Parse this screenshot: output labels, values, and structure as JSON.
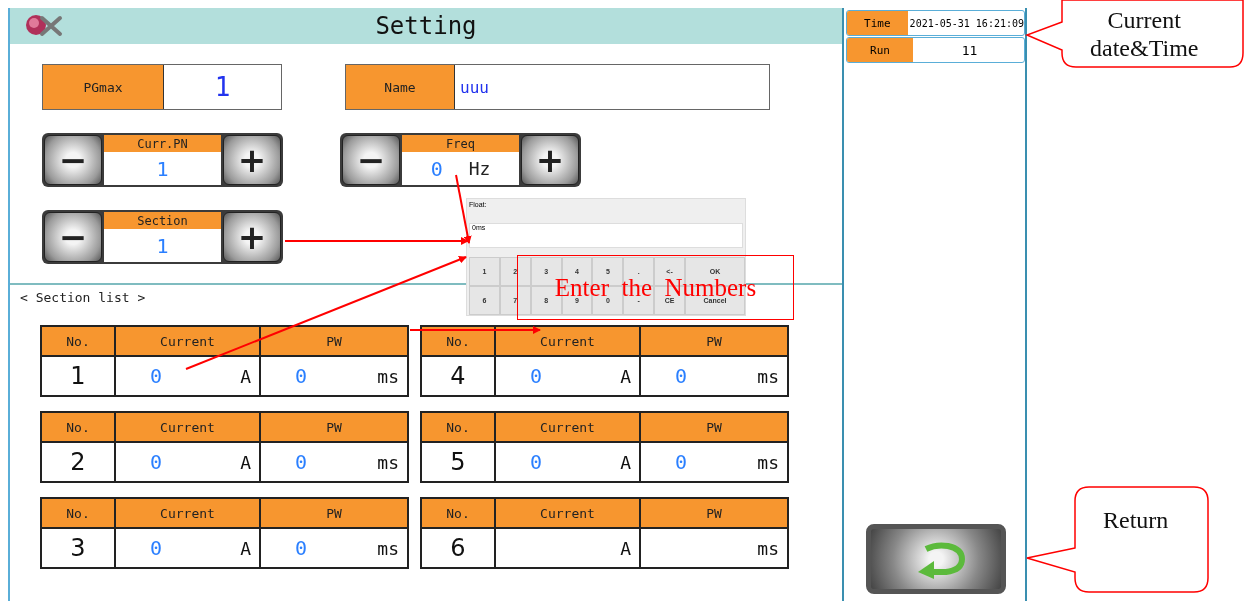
{
  "header": {
    "title": "Setting"
  },
  "pgmax": {
    "label": "PGmax",
    "value": "1"
  },
  "name": {
    "label": "Name",
    "value": "uuu"
  },
  "steppers": [
    {
      "label": "Curr.PN",
      "value": "1",
      "decrement": "−",
      "increment": "+"
    },
    {
      "label": "Freq",
      "value": "0",
      "unit": "Hz",
      "decrement": "−",
      "increment": "+"
    },
    {
      "label": "Section",
      "value": "1",
      "decrement": "−",
      "increment": "+"
    }
  ],
  "section_list": {
    "title": "< Section list >",
    "sections": [
      {
        "no_label": "No.",
        "current_label": "Current",
        "pw_label": "PW",
        "no": "1",
        "current": "0",
        "current_unit": "A",
        "pw": "0",
        "pw_unit": "ms"
      },
      {
        "no_label": "No.",
        "current_label": "Current",
        "pw_label": "PW",
        "no": "4",
        "current": "0",
        "current_unit": "A",
        "pw": "0",
        "pw_unit": "ms"
      },
      {
        "no_label": "No.",
        "current_label": "Current",
        "pw_label": "PW",
        "no": "2",
        "current": "0",
        "current_unit": "A",
        "pw": "0",
        "pw_unit": "ms"
      },
      {
        "no_label": "No.",
        "current_label": "Current",
        "pw_label": "PW",
        "no": "5",
        "current": "0",
        "current_unit": "A",
        "pw": "0",
        "pw_unit": "ms"
      },
      {
        "no_label": "No.",
        "current_label": "Current",
        "pw_label": "PW",
        "no": "3",
        "current": "0",
        "current_unit": "A",
        "pw": "0",
        "pw_unit": "ms"
      },
      {
        "no_label": "No.",
        "current_label": "Current",
        "pw_label": "PW",
        "no": "6",
        "current_unit": "A",
        "pw_unit": "ms"
      }
    ]
  },
  "status": {
    "time_label": "Time",
    "time": "2021-05-31 16:21:09",
    "run_label": "Run",
    "run": "11"
  },
  "keypad": {
    "title": "Float:",
    "display": "0ms",
    "keys": [
      [
        "1",
        "2",
        "3",
        "4",
        "5",
        ".",
        "<-",
        "OK"
      ],
      [
        "6",
        "7",
        "8",
        "9",
        "0",
        "-",
        "CE",
        "Cancel"
      ]
    ]
  },
  "annotations": {
    "note": "Enter  the  Numbers",
    "callouts": [
      {
        "kind": "time",
        "lines": [
          "Current",
          "date&Time"
        ]
      },
      {
        "kind": "return",
        "lines": [
          "Return"
        ]
      }
    ]
  }
}
